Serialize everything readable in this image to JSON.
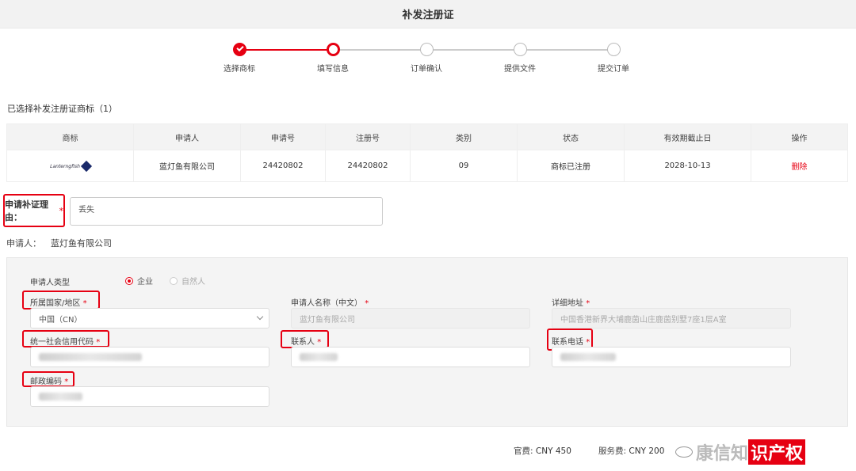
{
  "page": {
    "title": "补发注册证"
  },
  "steps": [
    {
      "label": "选择商标",
      "state": "done"
    },
    {
      "label": "填写信息",
      "state": "active"
    },
    {
      "label": "订单确认",
      "state": "todo"
    },
    {
      "label": "提供文件",
      "state": "todo"
    },
    {
      "label": "提交订单",
      "state": "todo"
    }
  ],
  "selected_title": "已选择补发注册证商标（1）",
  "table": {
    "headers": [
      "商标",
      "申请人",
      "申请号",
      "注册号",
      "类别",
      "状态",
      "有效期截止日",
      "操作"
    ],
    "row": {
      "logo_text": "Lanterngfish",
      "applicant": "蓝灯鱼有限公司",
      "app_no": "24420802",
      "reg_no": "24420802",
      "class": "09",
      "status": "商标已注册",
      "expiry": "2028-10-13",
      "action": "删除"
    }
  },
  "reason": {
    "label": "申请补证理由：",
    "required": "*",
    "value": "丢失"
  },
  "applicant_line": {
    "label": "申请人：",
    "value": "蓝灯鱼有限公司"
  },
  "form": {
    "type_label": "申请人类型",
    "type_options": [
      "企业",
      "自然人"
    ],
    "country_label": "所属国家/地区",
    "country_value": "中国（CN）",
    "name_label": "申请人名称（中文）",
    "name_value": "蓝灯鱼有限公司",
    "address_label": "详细地址",
    "address_value": "中国香港新界大埔鹿茵山庄鹿茵别墅7座1层A室",
    "credit_label": "统一社会信用代码",
    "contact_label": "联系人",
    "phone_label": "联系电话",
    "postal_label": "邮政编码",
    "required": "*"
  },
  "fees": {
    "official_label": "官费:",
    "official_value": "CNY 450",
    "service_label": "服务费:",
    "service_value": "CNY 200"
  },
  "watermark": {
    "text": "康信知",
    "highlight": "识产权"
  },
  "colors": {
    "accent": "#e60012"
  }
}
